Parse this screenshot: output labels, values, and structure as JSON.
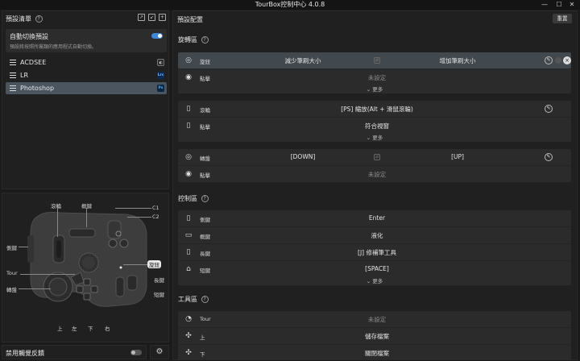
{
  "window": {
    "title": "TourBox控制中心 4.0.8",
    "min": "—",
    "max": "☐",
    "close": "✕"
  },
  "presets_panel": {
    "title": "預設清單",
    "auto_switch": {
      "title": "自動切換預設",
      "subtitle": "預設將按照所屬類的應用程式自動切換。",
      "enabled": true
    },
    "presets": [
      {
        "name": "ACDSEE",
        "badge": "",
        "badge_color": "#2b2b2b",
        "active": false
      },
      {
        "name": "LR",
        "badge": "Lrc",
        "badge_color": "#0a2b57",
        "active": false
      },
      {
        "name": "Photoshop",
        "badge": "Ps",
        "badge_color": "#0b2545",
        "active": true
      }
    ]
  },
  "device": {
    "labels": {
      "scroll": "滾輪",
      "tall": "概鍵",
      "c1": "C1",
      "c2": "C2",
      "side": "側鍵",
      "tour": "Tour",
      "knob": "旋鈕",
      "long": "長鍵",
      "dial": "轉盤",
      "short": "短鍵",
      "up": "上",
      "left": "左",
      "down": "下",
      "right": "右"
    }
  },
  "footer": {
    "haptic_label": "禁用觸覺反饋",
    "haptic_enabled": false
  },
  "config": {
    "title": "預設配置",
    "reset": "重置",
    "rotation_section": "旋轉區",
    "more": "更多",
    "knob_rows": [
      {
        "label": "旋鈕",
        "left": "減少筆刷大小",
        "right": "增加筆刷大小"
      },
      {
        "label": "點擊",
        "center": "未設定"
      }
    ],
    "scroll_rows": [
      {
        "label": "滾輪",
        "center": "[PS] 縮放(Alt + 滑鼠滾輪)"
      },
      {
        "label": "點擊",
        "center": "符合視窗"
      }
    ],
    "dial_rows": [
      {
        "label": "轉盤",
        "left": "[DOWN]",
        "right": "[UP]"
      },
      {
        "label": "點擊",
        "center": "未設定"
      }
    ],
    "control_section": "控制區",
    "control_rows": [
      {
        "label": "側鍵",
        "center": "Enter"
      },
      {
        "label": "概鍵",
        "center": "液化"
      },
      {
        "label": "長鍵",
        "center": "[J] 修補筆工具"
      },
      {
        "label": "短鍵",
        "center": "[SPACE]"
      }
    ],
    "tool_section": "工具區",
    "tool_rows": [
      {
        "label": "Tour",
        "center": "未設定"
      },
      {
        "label": "上",
        "center": "儲存檔案"
      },
      {
        "label": "下",
        "center": "關閉檔案"
      }
    ]
  }
}
